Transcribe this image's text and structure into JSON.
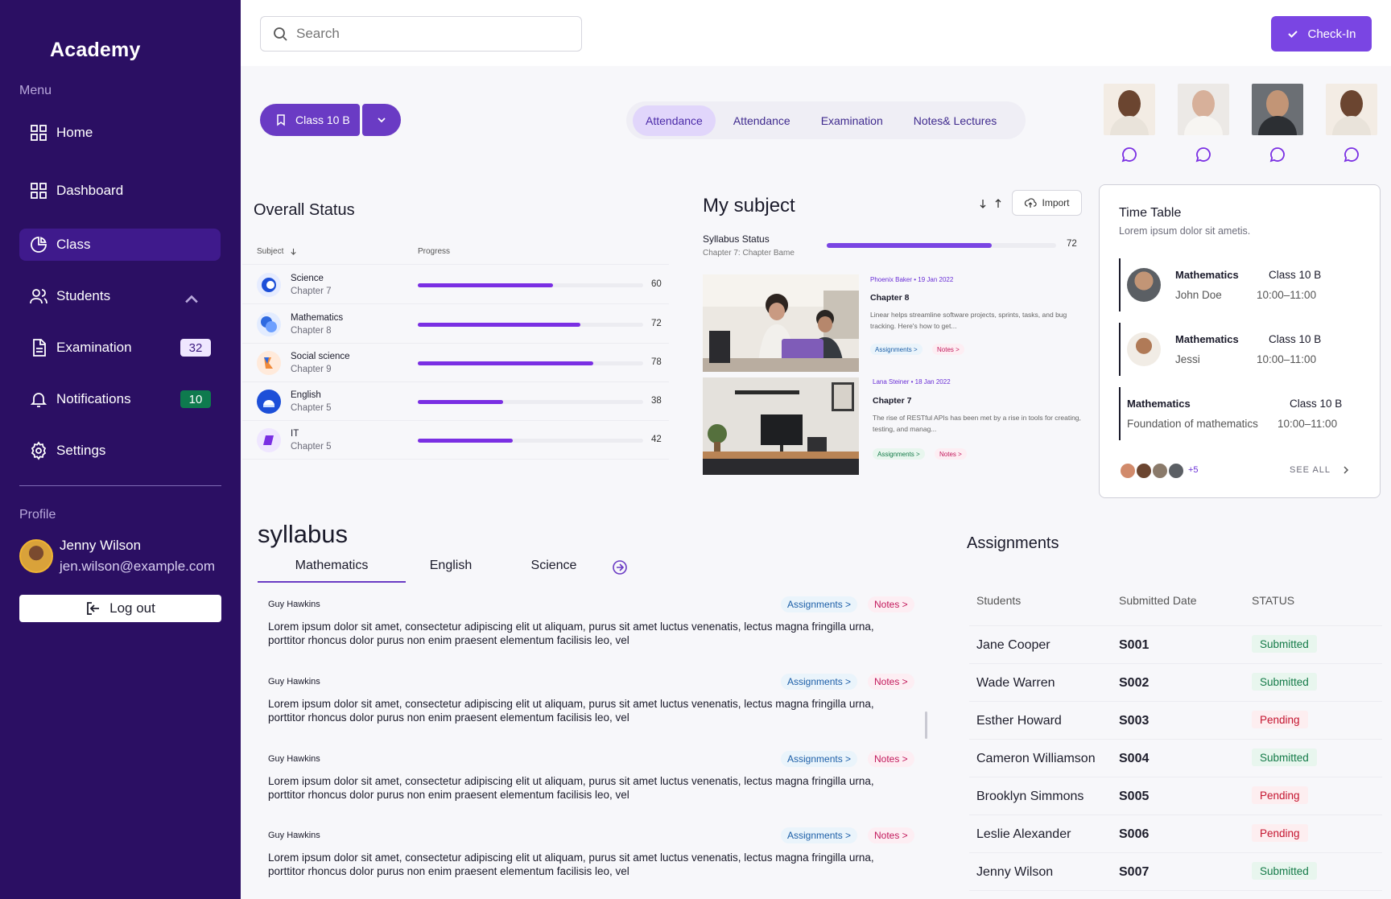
{
  "app": {
    "brand": "Academy",
    "menu_label": "Menu",
    "profile_label": "Profile"
  },
  "nav": {
    "home": "Home",
    "dashboard": "Dashboard",
    "class": "Class",
    "students": "Students",
    "examination": "Examination",
    "examination_count": "32",
    "notifications": "Notifications",
    "notifications_count": "10",
    "settings": "Settings"
  },
  "profile": {
    "name": "Jenny Wilson",
    "email": "jen.wilson@example.com",
    "logout_label": "Log out"
  },
  "topbar": {
    "search_placeholder": "Search",
    "checkin_label": "Check-In"
  },
  "class_selector": {
    "label": "Class 10 B"
  },
  "tabs": [
    "Attendance",
    "Attendance",
    "Examination",
    "Notes& Lectures"
  ],
  "overall_status": {
    "title": "Overall Status",
    "col_subject": "Subject",
    "col_progress": "Progress",
    "rows": [
      {
        "subject": "Science",
        "chapter": "Chapter 7",
        "progress": 60
      },
      {
        "subject": "Mathematics",
        "chapter": "Chapter 8",
        "progress": 72
      },
      {
        "subject": "Social science",
        "chapter": "Chapter 9",
        "progress": 78
      },
      {
        "subject": "English",
        "chapter": "Chapter 5",
        "progress": 38
      },
      {
        "subject": "IT",
        "chapter": "Chapter 5",
        "progress": 42
      }
    ]
  },
  "my_subject": {
    "title": "My subject",
    "import_label": "Import",
    "syllabus_status": "Syllabus Status",
    "syllabus_sub": "Chapter 7: Chapter Bame",
    "syllabus_progress": 72,
    "cards": [
      {
        "meta": "Phoenix Baker • 19 Jan 2022",
        "title": "Chapter 8",
        "desc": "Linear helps streamline software projects, sprints, tasks, and bug tracking. Here's how to get...",
        "tag1": "Assignments >",
        "tag2": "Notes >"
      },
      {
        "meta": "Lana Steiner • 18 Jan 2022",
        "title": "Chapter 7",
        "desc": "The rise of RESTful APIs has been met by a rise in tools for creating, testing, and manag...",
        "tag1": "Assignments >",
        "tag2": "Notes >"
      }
    ]
  },
  "timetable": {
    "title": "Time Table",
    "subtitle": "Lorem ipsum dolor sit ametis.",
    "items": [
      {
        "subject": "Mathematics",
        "class": "Class 10 B",
        "name": "John Doe",
        "time": "10:00–11:00"
      },
      {
        "subject": "Mathematics",
        "class": "Class 10 B",
        "name": "Jessi",
        "time": "10:00–11:00"
      },
      {
        "subject": "Mathematics",
        "class": "Class 10 B",
        "name": "Foundation of mathematics",
        "time": "10:00–11:00"
      }
    ],
    "more_count": "+5",
    "see_all": "SEE ALL"
  },
  "syllabus": {
    "title": "syllabus",
    "tabs": [
      "Mathematics",
      "English",
      "Science"
    ],
    "entries": [
      {
        "author": "Guy Hawkins",
        "text": "Lorem ipsum dolor sit amet, consectetur adipiscing elit ut aliquam, purus sit amet luctus venenatis, lectus magna fringilla urna, porttitor rhoncus dolor purus non enim praesent elementum facilisis leo, vel",
        "tag1": "Assignments >",
        "tag2": "Notes >"
      },
      {
        "author": "Guy Hawkins",
        "text": "Lorem ipsum dolor sit amet, consectetur adipiscing elit ut aliquam, purus sit amet luctus venenatis, lectus magna fringilla urna, porttitor rhoncus dolor purus non enim praesent elementum facilisis leo, vel",
        "tag1": "Assignments >",
        "tag2": "Notes >"
      },
      {
        "author": "Guy Hawkins",
        "text": "Lorem ipsum dolor sit amet, consectetur adipiscing elit ut aliquam, purus sit amet luctus venenatis, lectus magna fringilla urna, porttitor rhoncus dolor purus non enim praesent elementum facilisis leo, vel",
        "tag1": "Assignments >",
        "tag2": "Notes >"
      },
      {
        "author": "Guy Hawkins",
        "text": "Lorem ipsum dolor sit amet, consectetur adipiscing elit ut aliquam, purus sit amet luctus venenatis, lectus magna fringilla urna, porttitor rhoncus dolor purus non enim praesent elementum facilisis leo, vel",
        "tag1": "Assignments >",
        "tag2": "Notes >"
      }
    ]
  },
  "assignments": {
    "title": "Assignments",
    "col_students": "Students",
    "col_date": "Submitted Date",
    "col_status": "STATUS",
    "rows": [
      {
        "student": "Jane Cooper",
        "id": "S001",
        "status": "Submitted"
      },
      {
        "student": "Wade Warren",
        "id": "S002",
        "status": "Submitted"
      },
      {
        "student": "Esther Howard",
        "id": "S003",
        "status": "Pending"
      },
      {
        "student": "Cameron Williamson",
        "id": "S004",
        "status": "Submitted"
      },
      {
        "student": "Brooklyn Simmons",
        "id": "S005",
        "status": "Pending"
      },
      {
        "student": "Leslie Alexander",
        "id": "S006",
        "status": "Pending"
      },
      {
        "student": "Jenny Wilson",
        "id": "S007",
        "status": "Submitted"
      }
    ]
  },
  "colors": {
    "sidebar": "#2b0f63",
    "accent": "#7a45e3",
    "progress": "#7a2fe3",
    "submitted": "#147a48",
    "pending": "#c4142f"
  }
}
